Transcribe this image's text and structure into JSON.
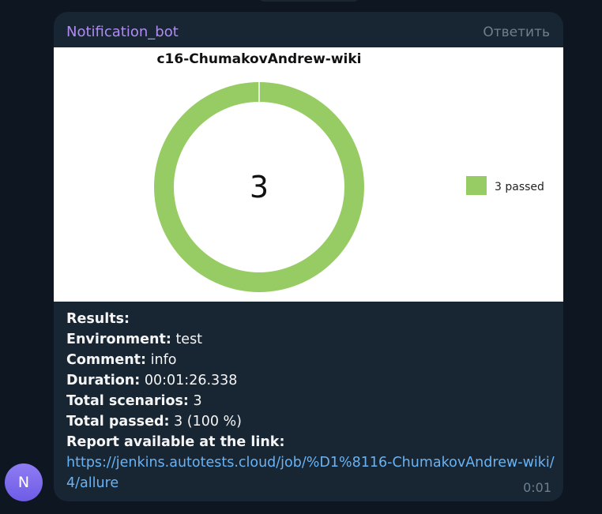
{
  "message": {
    "sender": "Notification_bot",
    "reply_label": "Ответить",
    "avatar_letter": "N",
    "time": "0:01"
  },
  "chart_data": {
    "type": "pie",
    "title": "c16-ChumakovAndrew-wiki",
    "center_label": "3",
    "categories": [
      "passed"
    ],
    "values": [
      3
    ],
    "legend": [
      "3 passed"
    ],
    "legend_position": "right",
    "colors": [
      "#97cc64"
    ]
  },
  "results": {
    "heading": "Results:",
    "environment_label": "Environment:",
    "environment_value": "test",
    "comment_label": "Comment:",
    "comment_value": "info",
    "duration_label": "Duration:",
    "duration_value": "00:01:26.338",
    "scenarios_label": "Total scenarios:",
    "scenarios_value": "3",
    "passed_label": "Total passed:",
    "passed_value": "3 (100 %)",
    "report_label": "Report available at the link:",
    "report_link": "https://jenkins.autotests.cloud/job/%D1%8116-ChumakovAndrew-wiki/4/allure"
  },
  "colors": {
    "background": "#0e1621",
    "bubble": "#182533",
    "sender": "#b08cf2",
    "link": "#6ab3f3",
    "muted": "#6d7f8f"
  }
}
